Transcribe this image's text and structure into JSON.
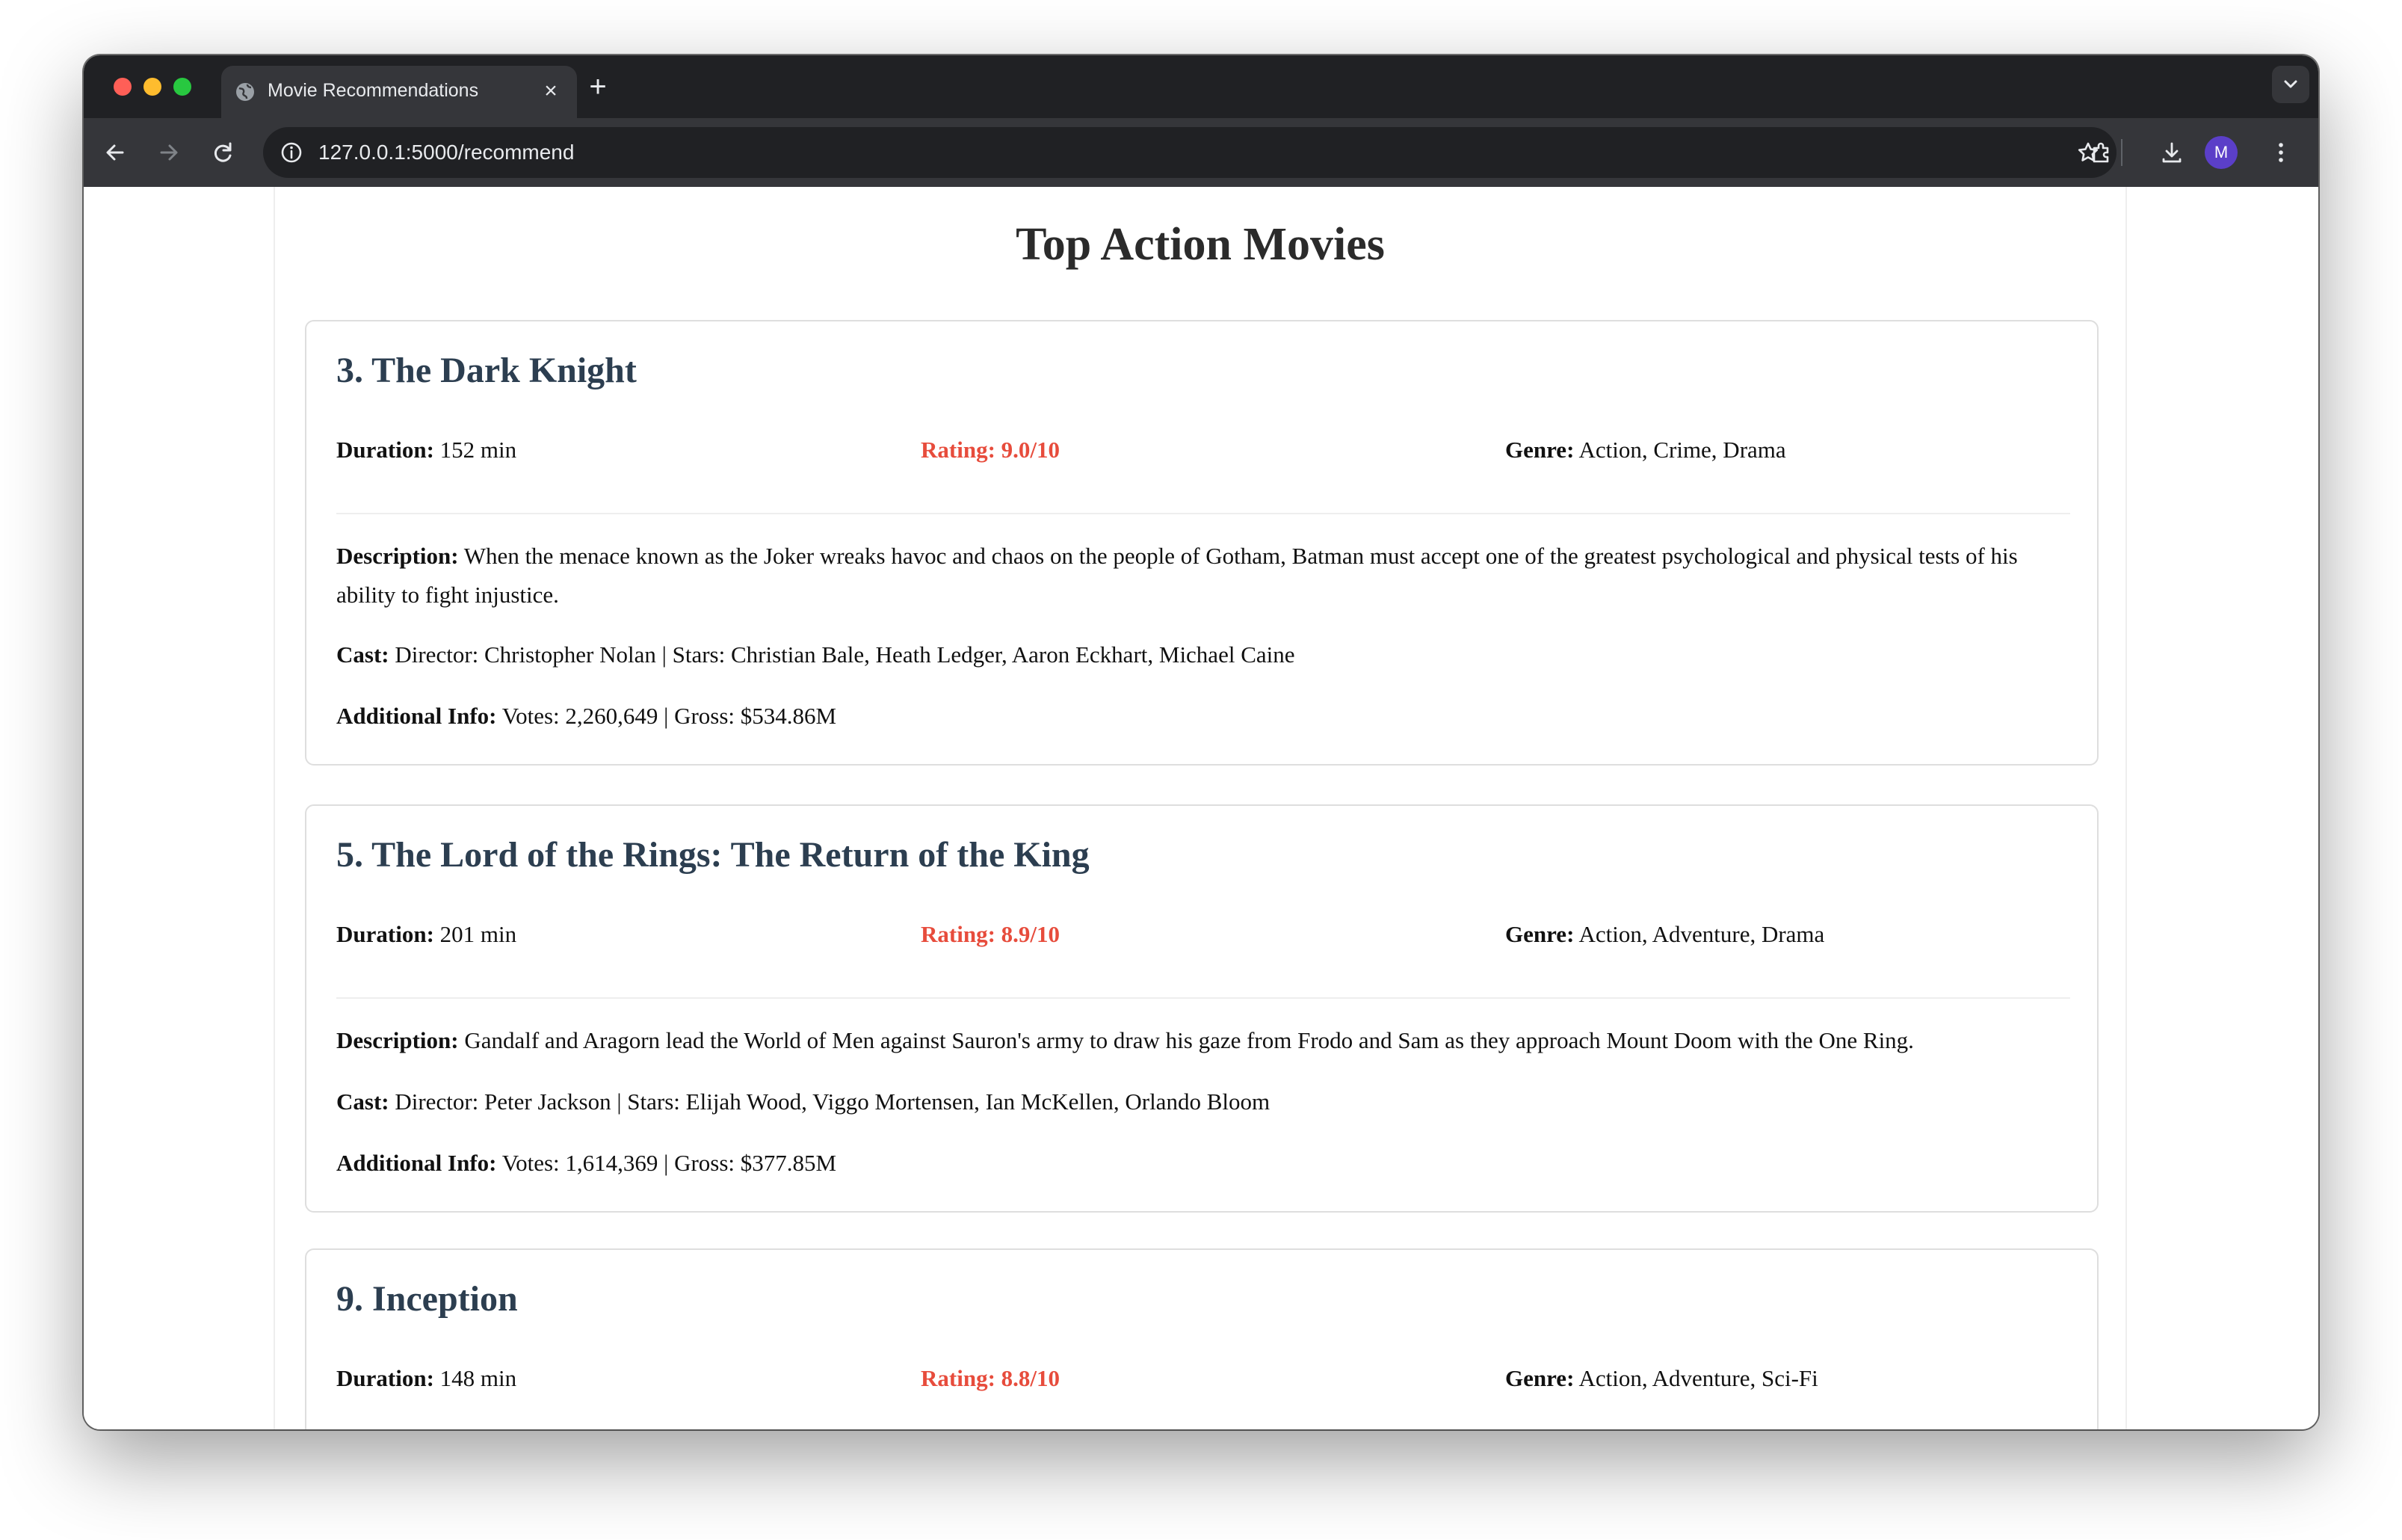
{
  "browser": {
    "tab_title": "Movie Recommendations",
    "url": "127.0.0.1:5000/recommend",
    "profile_initial": "M"
  },
  "page": {
    "heading": "Top Action Movies",
    "labels": {
      "duration": "Duration:",
      "genre": "Genre:",
      "description": "Description:",
      "cast": "Cast:",
      "additional_info": "Additional Info:"
    },
    "rating_color": "#e74c3c",
    "title_color": "#2c3e50",
    "movies": [
      {
        "title": "3. The Dark Knight",
        "duration": "152 min",
        "rating": "Rating: 9.0/10",
        "genre": "Action, Crime, Drama",
        "description": "When the menace known as the Joker wreaks havoc and chaos on the people of Gotham, Batman must accept one of the greatest psychological and physical tests of his ability to fight injustice.",
        "cast": "Director: Christopher Nolan | Stars: Christian Bale, Heath Ledger, Aaron Eckhart, Michael Caine",
        "additional_info": "Votes: 2,260,649 | Gross: $534.86M"
      },
      {
        "title": "5. The Lord of the Rings: The Return of the King",
        "duration": "201 min",
        "rating": "Rating: 8.9/10",
        "genre": "Action, Adventure, Drama",
        "description": "Gandalf and Aragorn lead the World of Men against Sauron's army to draw his gaze from Frodo and Sam as they approach Mount Doom with the One Ring.",
        "cast": "Director: Peter Jackson | Stars: Elijah Wood, Viggo Mortensen, Ian McKellen, Orlando Bloom",
        "additional_info": "Votes: 1,614,369 | Gross: $377.85M"
      },
      {
        "title": "9. Inception",
        "duration": "148 min",
        "rating": "Rating: 8.8/10",
        "genre": "Action, Adventure, Sci-Fi"
      }
    ]
  }
}
